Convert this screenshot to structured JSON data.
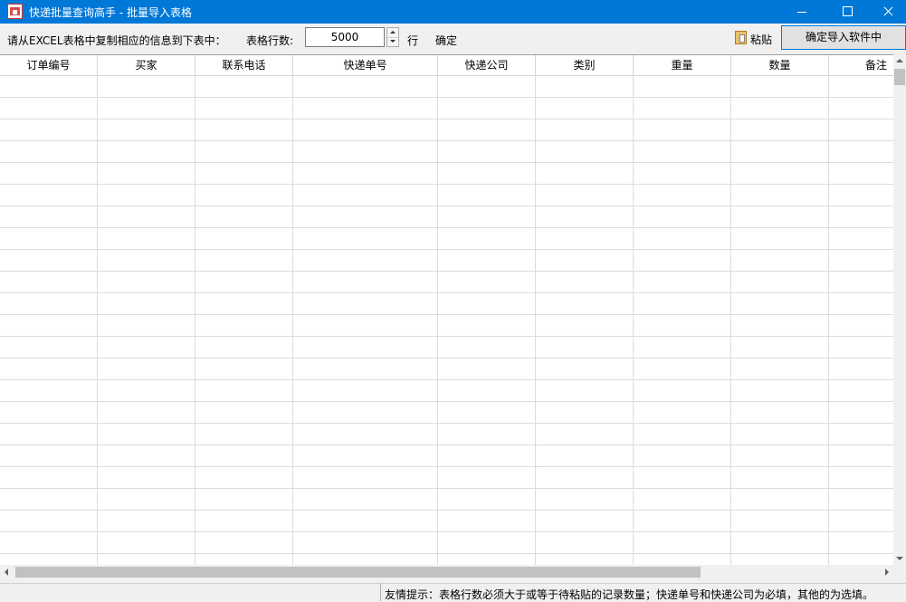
{
  "window": {
    "title": "快递批量查询高手 - 批量导入表格",
    "icon": "app-logo-icon"
  },
  "toolbar": {
    "instruction": "请从EXCEL表格中复制相应的信息到下表中：",
    "rows_label": "表格行数:",
    "rows_value": "5000",
    "rows_unit": "行",
    "confirm_label": "确定",
    "paste_label": "粘贴",
    "import_label": "确定导入软件中"
  },
  "grid": {
    "columns": [
      "订单编号",
      "买家",
      "联系电话",
      "快递单号",
      "快递公司",
      "类别",
      "重量",
      "数量",
      "备注"
    ],
    "rows": []
  },
  "status": {
    "hint": "友情提示：表格行数必须大于或等于待粘贴的记录数量；快递单号和快递公司为必填，其他的为选填。"
  },
  "colors": {
    "titlebar": "#0078d7",
    "button_focus_border": "#0078d7"
  }
}
